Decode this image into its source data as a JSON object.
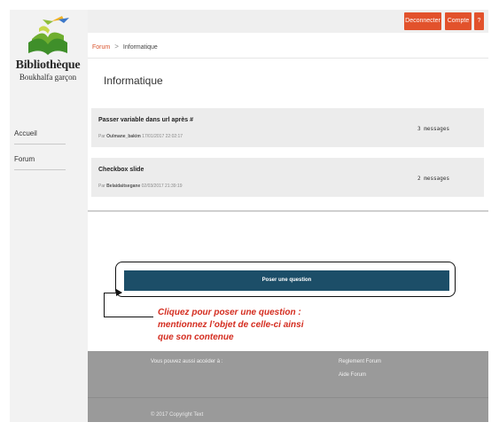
{
  "sidebar": {
    "logo_title": "Bibliothèque",
    "logo_subtitle": "Boukhalfa garçon",
    "items": [
      {
        "label": "Accueil"
      },
      {
        "label": "Forum"
      }
    ]
  },
  "topbar": {
    "buttons": [
      {
        "label": "Deconnecter"
      },
      {
        "label": "Compte"
      },
      {
        "label": "?"
      }
    ]
  },
  "breadcrumb": {
    "root": "Forum",
    "separator": ">",
    "current": "Informatique"
  },
  "page": {
    "title": "Informatique"
  },
  "topics": [
    {
      "title": "Passer variable dans url après #",
      "by": "Par",
      "author": "Oulmane_bakim",
      "date": "17/01/2017 22:02:17",
      "count": "3 messages"
    },
    {
      "title": "Checkbox slide",
      "by": "Par",
      "author": "Belaidaitsegane",
      "date": "02/03/2017 21:39:19",
      "count": "2 messages"
    }
  ],
  "ask": {
    "button_label": "Poser une question",
    "callout_line1": "Cliquez pour poser une question :",
    "callout_line2": "mentionnez l’objet  de celle-ci  ainsi",
    "callout_line3": "que son contenue"
  },
  "footer": {
    "access_label": "Vous pouvez aussi accéder à :",
    "links": [
      {
        "label": "Reglement Forum"
      },
      {
        "label": "Aide Forum"
      }
    ],
    "copyright": "© 2017 Copyright Text"
  },
  "colors": {
    "accent": "#e2522c",
    "primary_button": "#1c4e68",
    "callout_text": "#d42c1f",
    "footer": "#9a9a9a"
  }
}
